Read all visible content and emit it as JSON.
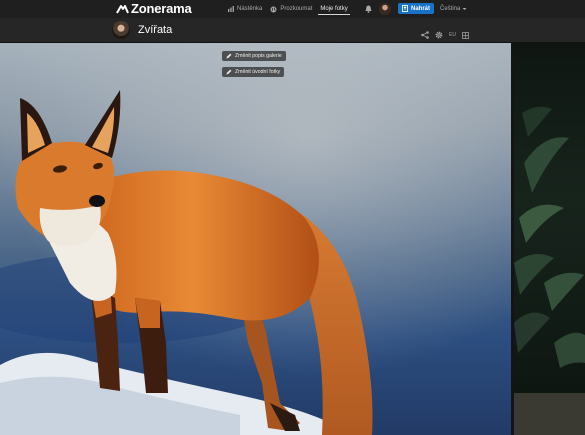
{
  "app": {
    "logo_text": "Zonerama"
  },
  "nav": {
    "dashboard": "Nástěnka",
    "explore": "Prozkoumat",
    "my_photos": "Moje fotky",
    "upload": "Nahrát",
    "language": "Čeština"
  },
  "gallery": {
    "title": "Zvířata",
    "edit_description": "Změnit popis galerie",
    "edit_cover": "Změnit úvodní fotky",
    "tool_label": "EU"
  },
  "icons": [
    "zonerama-logo-icon",
    "chart-icon",
    "globe-icon",
    "bell-icon",
    "upload-icon",
    "chevron-down-icon",
    "share-icon",
    "gear-icon",
    "grid-icon",
    "pencil-icon"
  ],
  "colors": {
    "accent": "#1a72c8",
    "topbar": "#1f1f1f",
    "gallery_bar": "#262626"
  }
}
